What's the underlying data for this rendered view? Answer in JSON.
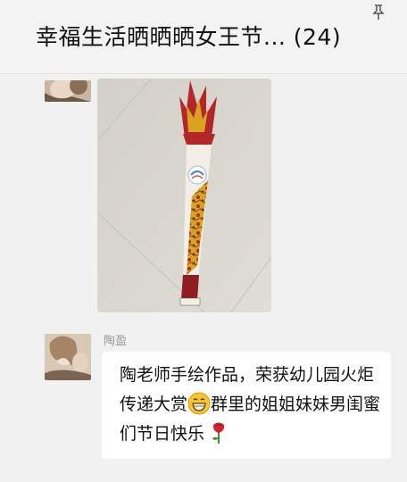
{
  "chat": {
    "title": "幸福生活晒晒晒女王节... (24)"
  },
  "icons": {
    "pin": "pin-icon",
    "grin": "grinning-face-emoji",
    "rose": "rose-emoji"
  },
  "messages": [
    {
      "type": "image",
      "content_description": "handmade paper torch artwork"
    },
    {
      "type": "text",
      "sender": "陶盈",
      "text_part1": "陶老师手绘作品，荣获幼儿园火炬传递大赏",
      "text_part2": "群里的姐姐妹妹男闺蜜们节日快乐"
    }
  ],
  "colors": {
    "background": "#f1f1f1",
    "bubble": "#ffffff",
    "torch_red": "#b3262a",
    "torch_gold": "#d9a321"
  }
}
